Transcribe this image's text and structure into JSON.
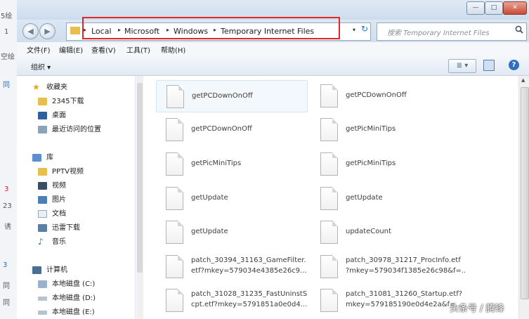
{
  "background_left": {
    "fragments": [
      "5绘",
      "1",
      "空绘",
      "同",
      "3",
      "23",
      "诱",
      "3",
      "同",
      "同"
    ]
  },
  "window": {
    "controls": {
      "minimize": "—",
      "maximize": "□",
      "close": "✕"
    }
  },
  "address": {
    "back_glyph": "◀",
    "forward_glyph": "▶",
    "breadcrumbs": [
      "Local",
      "Microsoft",
      "Windows",
      "Temporary Internet Files"
    ],
    "separator": "▸",
    "dropdown": "▾",
    "refresh": "↻",
    "search_placeholder": "搜索 Temporary Internet Files",
    "search_icon": "search-icon",
    "highlight_color": "#e0282a"
  },
  "menu": [
    "文件(F)",
    "编辑(E)",
    "查看(V)",
    "工具(T)",
    "帮助(H)"
  ],
  "toolbar": {
    "organize": "组织 ▾",
    "view_icon": "≣ ▾",
    "help": "?"
  },
  "nav": {
    "favorites": {
      "label": "收藏夹",
      "items": [
        "2345下载",
        "桌面",
        "最近访问的位置"
      ]
    },
    "libraries": {
      "label": "库",
      "items": [
        "PPTV视频",
        "视频",
        "图片",
        "文档",
        "迅雷下载",
        "音乐"
      ]
    },
    "computer": {
      "label": "计算机",
      "items": [
        "本地磁盘 (C:)",
        "本地磁盘 (D:)",
        "本地磁盘 (E:)"
      ]
    }
  },
  "files": [
    {
      "line1": "getPCDownOnOff",
      "line2": ""
    },
    {
      "line1": "getPCDownOnOff",
      "line2": ""
    },
    {
      "line1": "getPCDownOnOff",
      "line2": ""
    },
    {
      "line1": "getPicMiniTips",
      "line2": ""
    },
    {
      "line1": "getPicMiniTips",
      "line2": ""
    },
    {
      "line1": "getPicMiniTips",
      "line2": ""
    },
    {
      "line1": "getUpdate",
      "line2": ""
    },
    {
      "line1": "getUpdate",
      "line2": ""
    },
    {
      "line1": "getUpdate",
      "line2": ""
    },
    {
      "line1": "updateCount",
      "line2": ""
    },
    {
      "line1": "patch_30394_31163_GameFilter.",
      "line2": "etf?mkey=579034e4385e26c9..."
    },
    {
      "line1": "patch_30978_31217_ProcInfo.etf",
      "line2": "?mkey=579034f1385e26c98&f=..."
    },
    {
      "line1": "patch_31028_31235_FastUninstS",
      "line2": "cpt.etf?mkey=5791851a0e0d4..."
    },
    {
      "line1": "patch_31081_31260_Startup.etf?",
      "line2": "mkey=579185190e0d4e2a&f=..."
    }
  ],
  "watermark": "头条号 / 腾锋"
}
